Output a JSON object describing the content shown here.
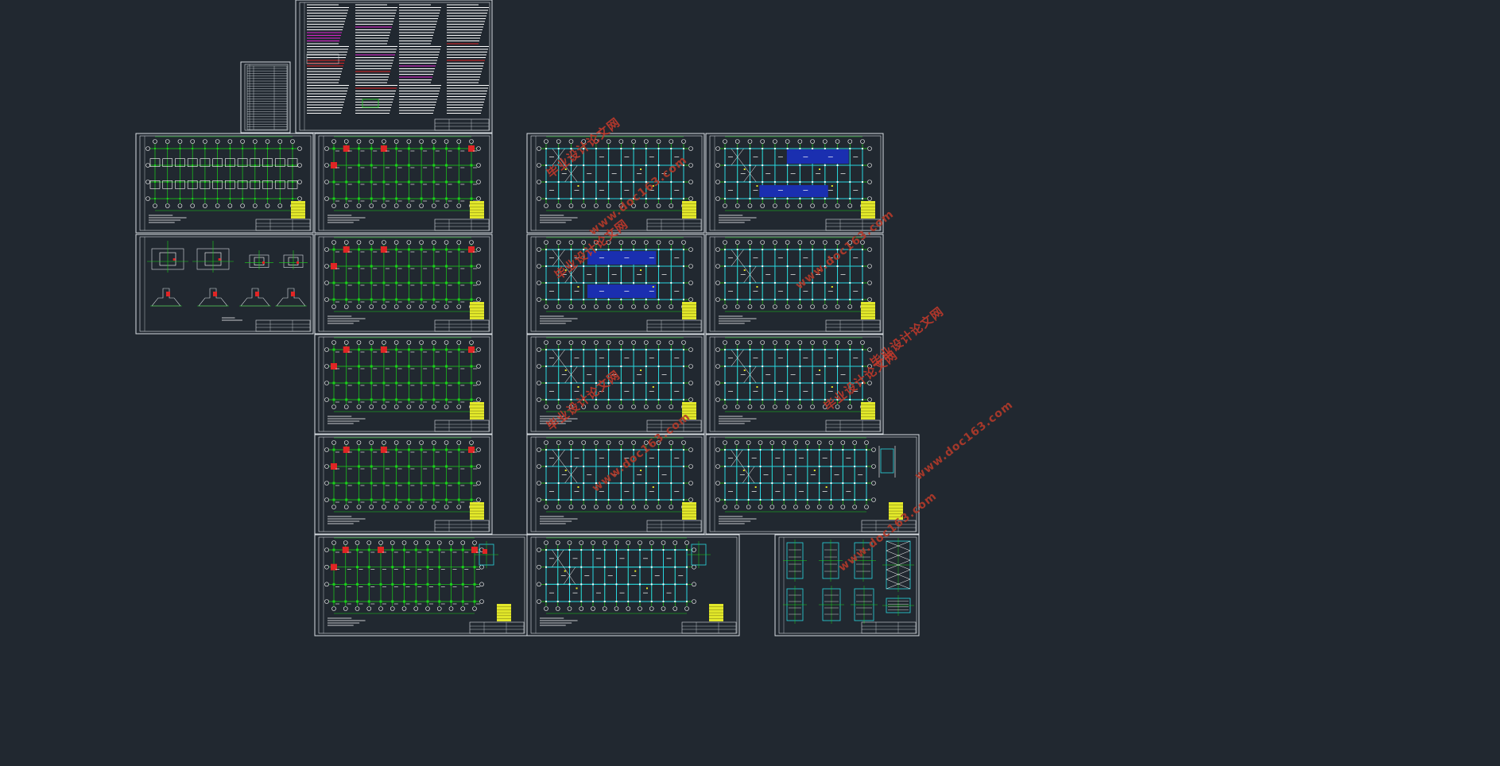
{
  "sheets": [
    {
      "id": "cover-notes",
      "kind": "notes"
    },
    {
      "id": "drawing-list",
      "kind": "list"
    },
    {
      "id": "foundation-plan",
      "kind": "grid-boxes"
    },
    {
      "id": "foundation-details",
      "kind": "details"
    },
    {
      "id": "column-plan-1",
      "kind": "grid-red"
    },
    {
      "id": "column-plan-2",
      "kind": "grid-red"
    },
    {
      "id": "column-plan-3",
      "kind": "grid-red"
    },
    {
      "id": "column-plan-4",
      "kind": "grid-red"
    },
    {
      "id": "column-plan-5",
      "kind": "grid-red"
    },
    {
      "id": "beam-plan-1",
      "kind": "grid-cyan"
    },
    {
      "id": "beam-plan-2",
      "kind": "grid-cyan-blue"
    },
    {
      "id": "beam-plan-3",
      "kind": "grid-cyan"
    },
    {
      "id": "beam-plan-4",
      "kind": "grid-cyan"
    },
    {
      "id": "beam-plan-5",
      "kind": "grid-cyan"
    },
    {
      "id": "slab-plan-1",
      "kind": "grid-blue"
    },
    {
      "id": "slab-plan-2",
      "kind": "grid-cyan"
    },
    {
      "id": "slab-plan-3",
      "kind": "grid-cyan"
    },
    {
      "id": "roof-plan",
      "kind": "roof"
    },
    {
      "id": "stair-details",
      "kind": "stair"
    }
  ],
  "colors": {
    "background": "#212830",
    "frame": "#d8dde2",
    "grid": "#19d219",
    "column": "#e02525",
    "beam": "#29d6e0",
    "slab": "#1a2fb0",
    "note": "#ffffff",
    "highlight": "#e2e82a",
    "magenta": "#e025d0"
  },
  "watermarks": [
    {
      "text": "毕业设计论文网",
      "style": "cn"
    },
    {
      "text": "www.doc163.com",
      "style": "url"
    },
    {
      "text": "毕业设计论文网",
      "style": "cn"
    },
    {
      "text": "www.doc163.com",
      "style": "url"
    },
    {
      "text": "毕业设计论文网",
      "style": "cn"
    },
    {
      "text": "www.doc163.com",
      "style": "url"
    },
    {
      "text": "毕业设计论文网",
      "style": "cn"
    },
    {
      "text": "www.doc163.com",
      "style": "url"
    },
    {
      "text": "毕业设计论文网",
      "style": "cn"
    },
    {
      "text": "www.doc163.com",
      "style": "url"
    }
  ]
}
